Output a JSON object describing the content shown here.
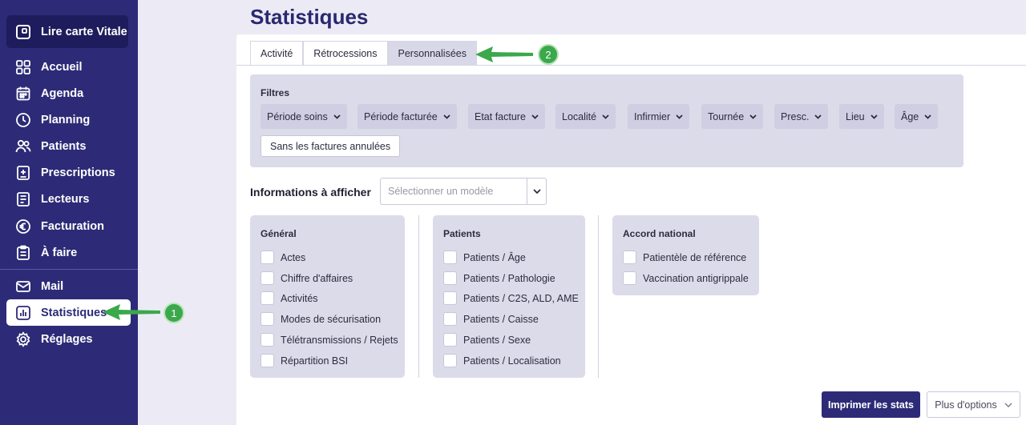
{
  "sidebar": {
    "vitale_label": "Lire carte Vitale",
    "items": [
      {
        "label": "Accueil",
        "icon": "grid-icon"
      },
      {
        "label": "Agenda",
        "icon": "calendar-icon"
      },
      {
        "label": "Planning",
        "icon": "clock-icon"
      },
      {
        "label": "Patients",
        "icon": "users-icon"
      },
      {
        "label": "Prescriptions",
        "icon": "prescription-icon"
      },
      {
        "label": "Lecteurs",
        "icon": "reader-icon"
      },
      {
        "label": "Facturation",
        "icon": "euro-icon"
      },
      {
        "label": "À faire",
        "icon": "todo-icon"
      },
      {
        "label": "Mail",
        "icon": "mail-icon"
      },
      {
        "label": "Statistiques",
        "icon": "stats-icon",
        "active": true
      },
      {
        "label": "Réglages",
        "icon": "gear-icon"
      }
    ]
  },
  "page": {
    "title": "Statistiques"
  },
  "tabs": [
    {
      "label": "Activité"
    },
    {
      "label": "Rétrocessions"
    },
    {
      "label": "Personnalisées",
      "active": true
    }
  ],
  "filters": {
    "title": "Filtres",
    "dropdowns": [
      "Période soins",
      "Période facturée",
      "Etat facture",
      "Localité",
      "Infirmier",
      "Tournée",
      "Presc.",
      "Lieu",
      "Âge"
    ],
    "toggle_label": "Sans les factures annulées"
  },
  "info": {
    "label": "Informations à afficher",
    "select_placeholder": "Sélectionner un modèle"
  },
  "panels": [
    {
      "title": "Général",
      "options": [
        "Actes",
        "Chiffre d'affaires",
        "Activités",
        "Modes de sécurisation",
        "Télétransmissions / Rejets",
        "Répartition BSI"
      ]
    },
    {
      "title": "Patients",
      "options": [
        "Patients / Âge",
        "Patients / Pathologie",
        "Patients / C2S, ALD, AME",
        "Patients / Caisse",
        "Patients / Sexe",
        "Patients / Localisation"
      ]
    },
    {
      "title": "Accord national",
      "options": [
        "Patientèle de référence",
        "Vaccination antigrippale"
      ]
    }
  ],
  "actions": {
    "print_label": "Imprimer les stats",
    "more_label": "Plus d'options"
  },
  "annotations": [
    {
      "number": "1",
      "color": "#3ba84c"
    },
    {
      "number": "2",
      "color": "#3ba84c"
    }
  ],
  "colors": {
    "sidebar": "#2d2b77",
    "accent": "#2d2b77",
    "panel": "#dcdbe9",
    "annotation": "#3ba84c"
  }
}
